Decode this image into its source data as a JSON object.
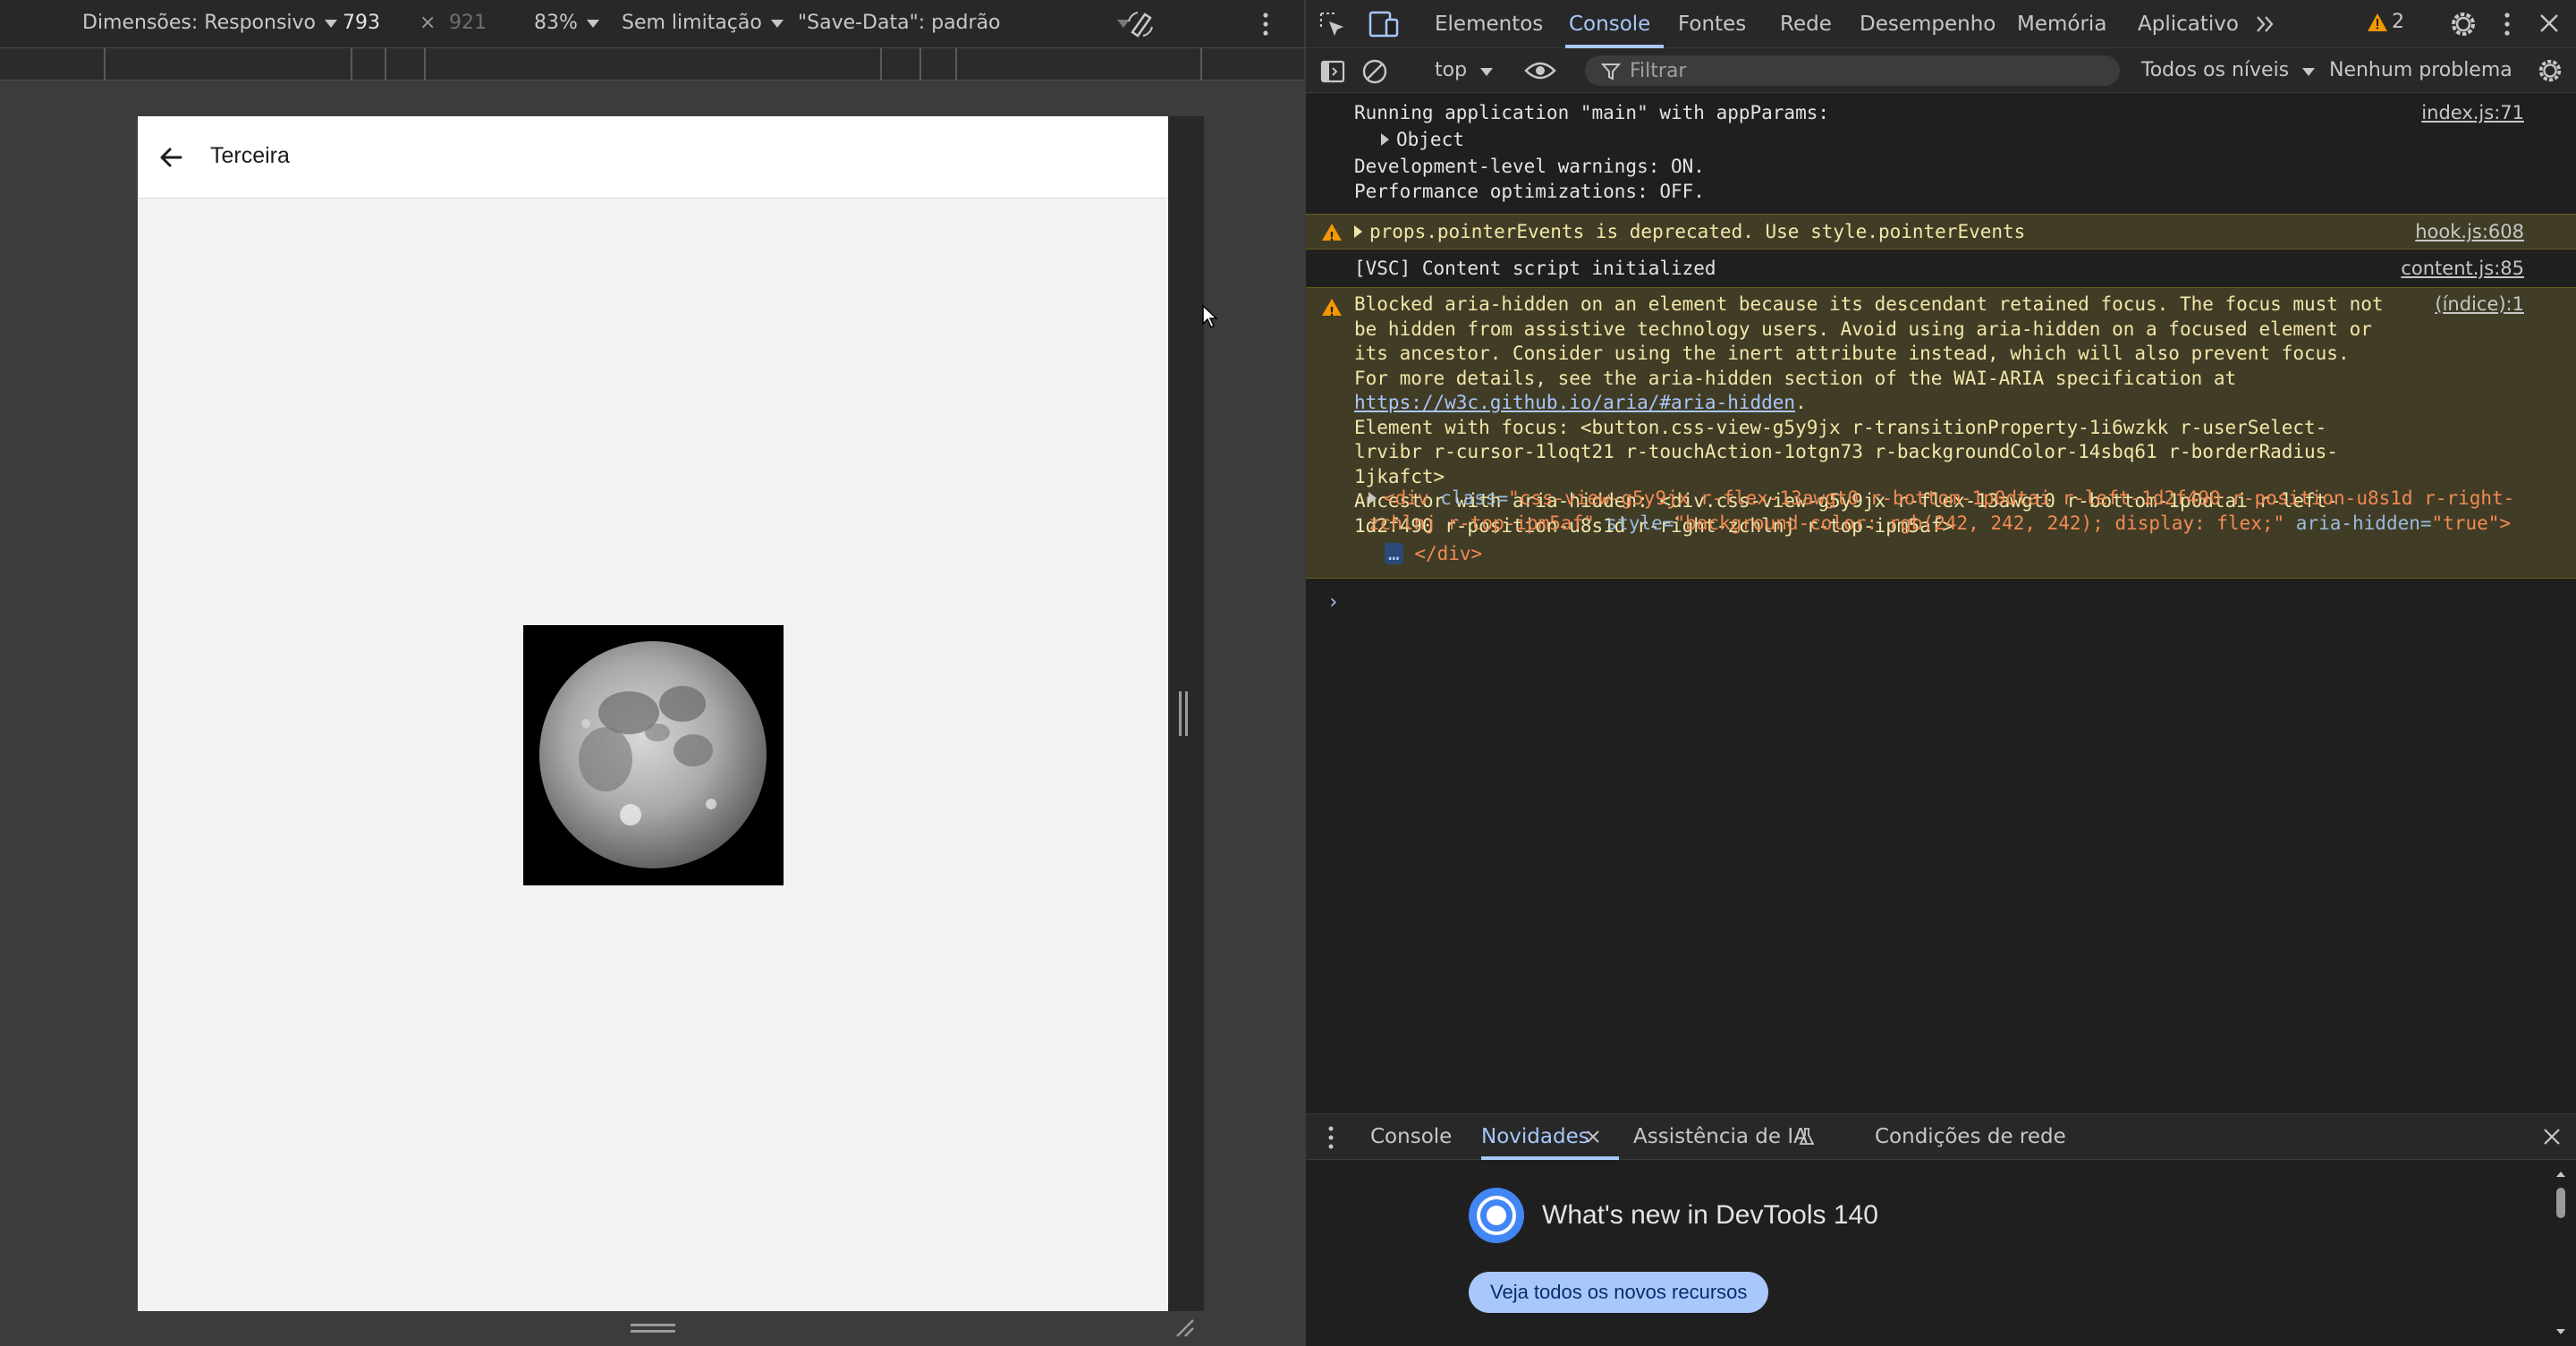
{
  "device_toolbar": {
    "dimensions_label": "Dimensões: Responsivo",
    "width": "793",
    "times": "×",
    "height": "921",
    "zoom": "83%",
    "throttling": "Sem limitação",
    "save_data": "\"Save-Data\": padrão"
  },
  "app": {
    "title": "Terceira"
  },
  "devtools": {
    "tabs": [
      "Elementos",
      "Console",
      "Fontes",
      "Rede",
      "Desempenho",
      "Memória",
      "Aplicativo"
    ],
    "active_tab": "Console",
    "warnings_count": "2",
    "toolbar": {
      "context": "top",
      "filter_placeholder": "Filtrar",
      "levels": "Todos os níveis",
      "issues": "Nenhum problema"
    },
    "console": {
      "msg1_lines": "Running application \"main\" with appParams:",
      "msg1_object": "Object",
      "msg1_line3": "Development-level warnings: ON.",
      "msg1_line4": "Performance optimizations: OFF.",
      "msg1_src": "index.js:71",
      "msg2_text": "props.pointerEvents is deprecated. Use style.pointerEvents",
      "msg2_src": "hook.js:608",
      "msg3_text": "[VSC] Content script initialized",
      "msg3_src": "content.js:85",
      "msg4_part1": "Blocked aria-hidden on an element because its descendant retained focus. The focus must not be hidden from assistive technology users. Avoid using aria-hidden on a focused element or its ancestor. Consider using the inert attribute instead, which will also prevent focus. For more details, see the aria-hidden section of the WAI-ARIA specification at ",
      "msg4_link": "https://w3c.github.io/aria/#aria-hidden",
      "msg4_part2": ".\nElement with focus: <button.css-view-g5y9jx r-transitionProperty-1i6wzkk r-userSelect-lrvibr r-cursor-1loqt21 r-touchAction-1otgn73 r-backgroundColor-14sbq61 r-borderRadius-1jkafct>\nAncestor with aria-hidden: <div.css-view-g5y9jx r-flex-13awgt0 r-bottom-1p0dtai r-left-1d2f490 r-position-u8s1d r-right-zchlnj r-top-ipm5af>",
      "msg4_src": "(índice):1",
      "msg4_html_tag_open": "<div ",
      "msg4_attr_class": "class",
      "msg4_attr_class_val": "\"css-view-g5y9jx r-flex-13awgt0 r-bottom-1p0dtai r-left-1d2f490 r-position-u8s1d r-right-zchlnj r-top-ipm5af\"",
      "msg4_attr_style": "style",
      "msg4_attr_style_val": "\"background-color: rgb(242, 242, 242); display: flex;\"",
      "msg4_attr_aria": "aria-hidden",
      "msg4_attr_aria_val": "\"true\"",
      "msg4_html_close": "</div>",
      "ellipsis": "…",
      "prompt": "›"
    },
    "drawer": {
      "tabs": [
        "Console",
        "Novidades",
        "Assistência de IA",
        "Condições de rede"
      ],
      "active_tab": "Novidades",
      "whatsnew_title": "What's new in DevTools 140",
      "whatsnew_button": "Veja todos os novos recursos"
    }
  },
  "colors": {
    "accent": "#a8c7fa",
    "warning_bg": "#413c26",
    "warning_icon": "#f29900"
  }
}
